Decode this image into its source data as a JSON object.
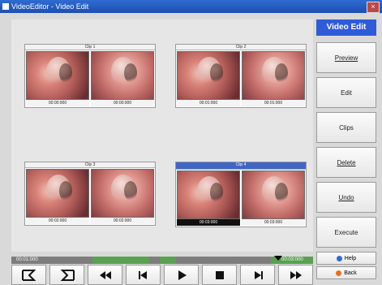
{
  "window": {
    "title": "VideoEditor - Video Edit"
  },
  "panel": {
    "title": "Video Edit",
    "buttons": [
      "Preview",
      "Edit",
      "Clips",
      "Delete",
      "Undo",
      "Execute"
    ],
    "help": "Help",
    "back": "Back"
  },
  "clips": [
    {
      "title": "Clip 1",
      "tc1": "00:00:000",
      "tc2": "00:00:000"
    },
    {
      "title": "Clip 2",
      "tc1": "00:01:000",
      "tc2": "00:01:000"
    },
    {
      "title": "Clip 3",
      "tc1": "00:02:000",
      "tc2": "00:02:000"
    },
    {
      "title": "Clip 4",
      "tc1": "00:03:000",
      "tc2": "00:03:000"
    }
  ],
  "timeline": {
    "left_label": "00:01:000",
    "right_label": "00:03:000"
  },
  "controls": [
    {
      "icon": "mark-in-icon"
    },
    {
      "icon": "mark-out-icon"
    },
    {
      "icon": "rewind-icon"
    },
    {
      "icon": "step-back-icon"
    },
    {
      "icon": "play-icon"
    },
    {
      "icon": "stop-icon"
    },
    {
      "icon": "step-forward-icon"
    },
    {
      "icon": "fast-forward-icon"
    }
  ],
  "colors": {
    "accent": "#2f5bd6",
    "selected_clip": "#3f66c4",
    "timeline_green": "#5aa052"
  }
}
